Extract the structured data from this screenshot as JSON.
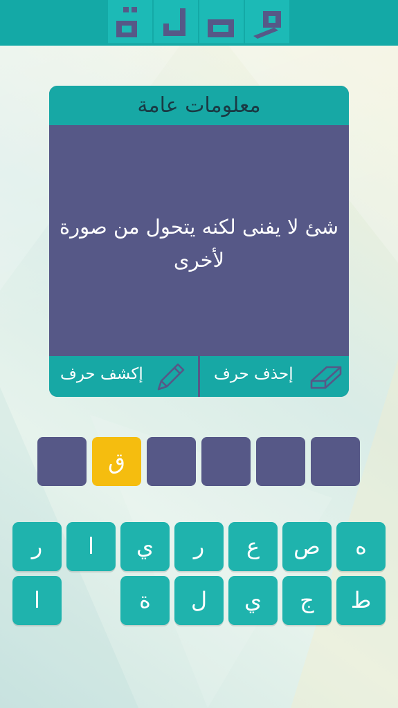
{
  "logo": {
    "letters": [
      "ة",
      "ل",
      "ص",
      "و"
    ],
    "icons": [
      "logo-letter-ta-marbuta",
      "logo-letter-lam",
      "logo-letter-sad",
      "logo-letter-waw"
    ],
    "color": "#565887"
  },
  "card": {
    "category": "معلومات عامة",
    "question": "شئ لا يفنى لكنه يتحول من صورة لأخرى",
    "reveal_label": "إكشف حرف",
    "reveal_icon": "pencil-icon",
    "delete_label": "إحذف حرف",
    "delete_icon": "eraser-icon"
  },
  "answer": {
    "slots": [
      "",
      "ق",
      "",
      "",
      "",
      ""
    ],
    "revealed_index": 1
  },
  "keyboard": {
    "row1": [
      "ر",
      "ا",
      "ي",
      "ر",
      "ع",
      "ص",
      "ه"
    ],
    "row2": [
      "ا",
      "",
      "ة",
      "ل",
      "ي",
      "ج",
      "ط"
    ]
  },
  "colors": {
    "teal": "#17a8a5",
    "purple": "#565887",
    "yellow": "#f5bd0f",
    "key": "#1fb3ad"
  }
}
